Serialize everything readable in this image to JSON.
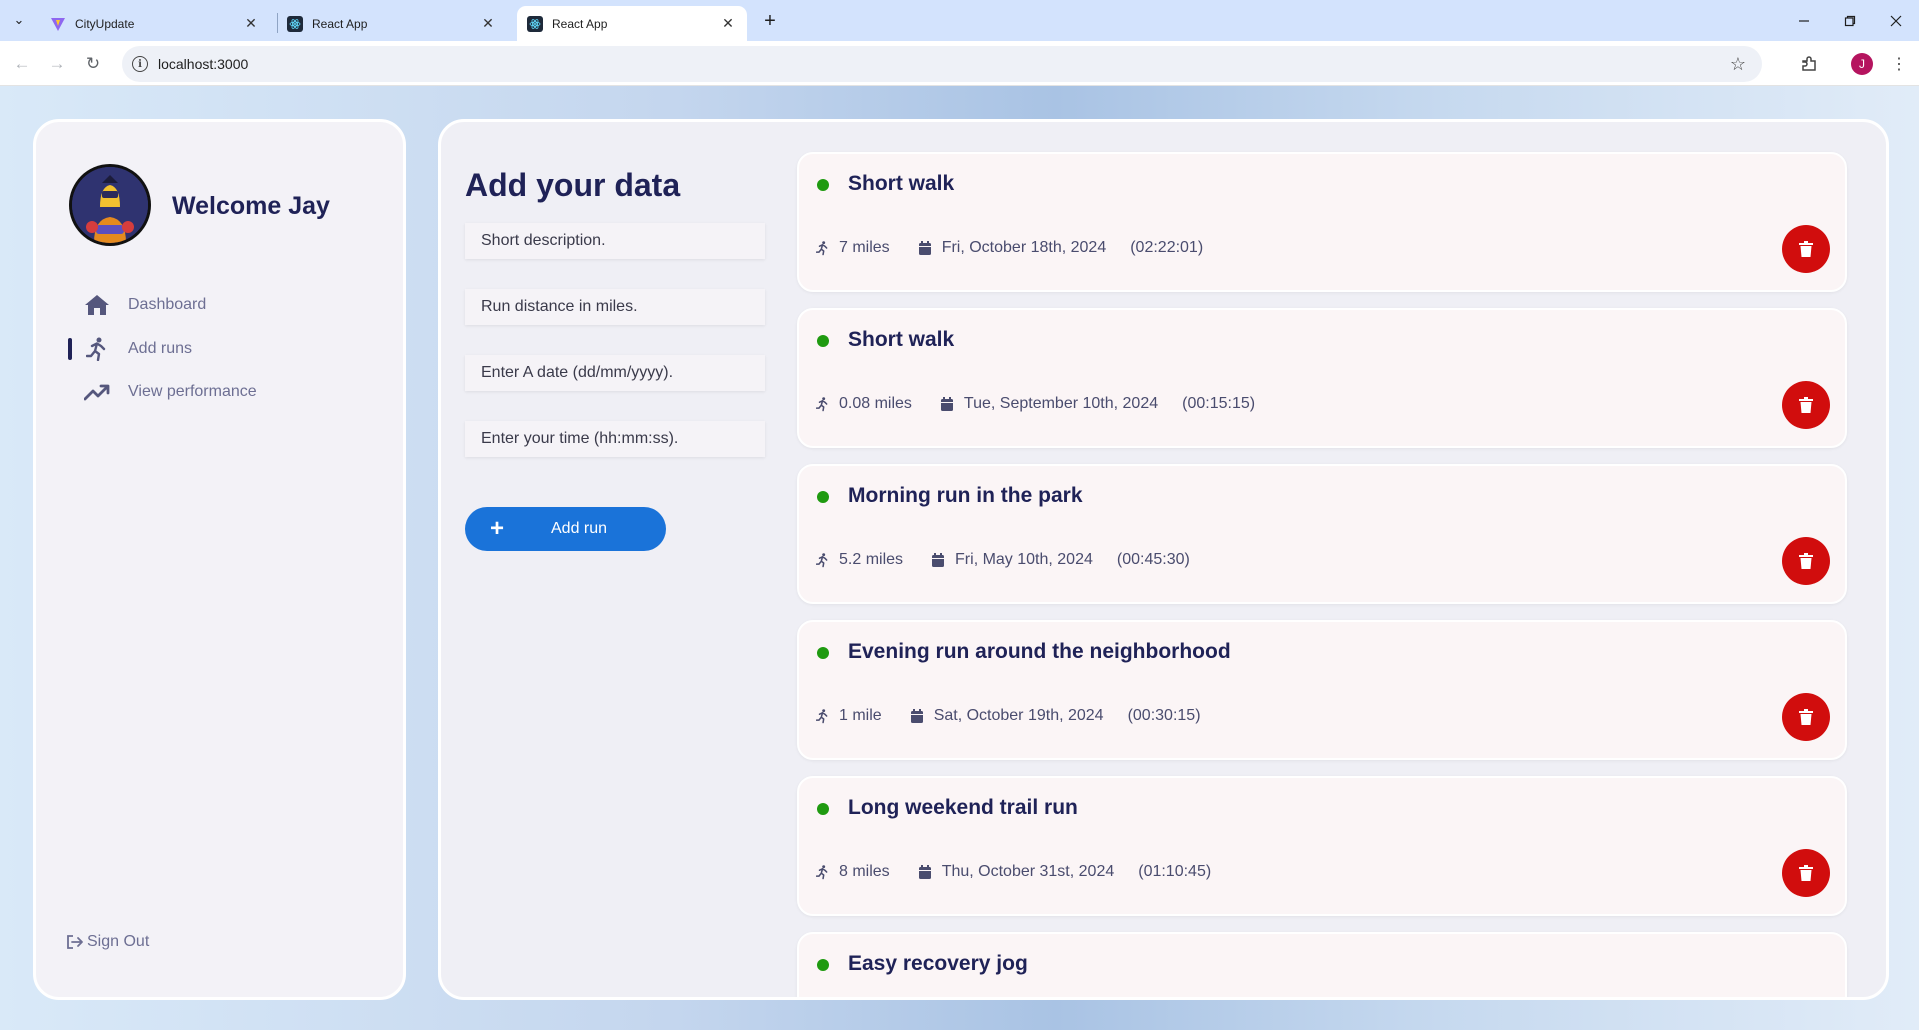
{
  "browser": {
    "tabs": [
      {
        "title": "CityUpdate",
        "favicon": "vite-icon",
        "active": false
      },
      {
        "title": "React App",
        "favicon": "react-icon",
        "active": false
      },
      {
        "title": "React App",
        "favicon": "react-icon",
        "active": true
      }
    ],
    "url": "localhost:3000",
    "profile_initial": "J"
  },
  "sidebar": {
    "welcome": "Welcome Jay",
    "nav": [
      {
        "label": "Dashboard",
        "icon": "home-icon"
      },
      {
        "label": "Add runs",
        "icon": "runner-icon",
        "active": true
      },
      {
        "label": "View performance",
        "icon": "trending-up-icon"
      }
    ],
    "sign_out": "Sign Out"
  },
  "form": {
    "title": "Add your data",
    "description_placeholder": "Short description.",
    "distance_placeholder": "Run distance in miles.",
    "date_placeholder": "Enter A date (dd/mm/yyyy).",
    "time_placeholder": "Enter your time (hh:mm:ss).",
    "add_button": "Add run",
    "add_button_icon": "+"
  },
  "runs": [
    {
      "title": "Short walk",
      "distance": "7 miles",
      "date": "Fri, October 18th, 2024",
      "time": "(02:22:01)"
    },
    {
      "title": "Short walk",
      "distance": "0.08 miles",
      "date": "Tue, September 10th, 2024",
      "time": "(00:15:15)"
    },
    {
      "title": "Morning run in the park",
      "distance": "5.2 miles",
      "date": "Fri, May 10th, 2024",
      "time": "(00:45:30)"
    },
    {
      "title": "Evening run around the neighborhood",
      "distance": "1 mile",
      "date": "Sat, October 19th, 2024",
      "time": "(00:30:15)"
    },
    {
      "title": "Long weekend trail run",
      "distance": "8 miles",
      "date": "Thu, October 31st, 2024",
      "time": "(01:10:45)"
    },
    {
      "title": "Easy recovery jog",
      "distance": "",
      "date": "",
      "time": ""
    }
  ],
  "colors": {
    "accent": "#1a73d9",
    "delete": "#d10d0d",
    "status_dot": "#1f9a10",
    "heading": "#1f2257"
  }
}
